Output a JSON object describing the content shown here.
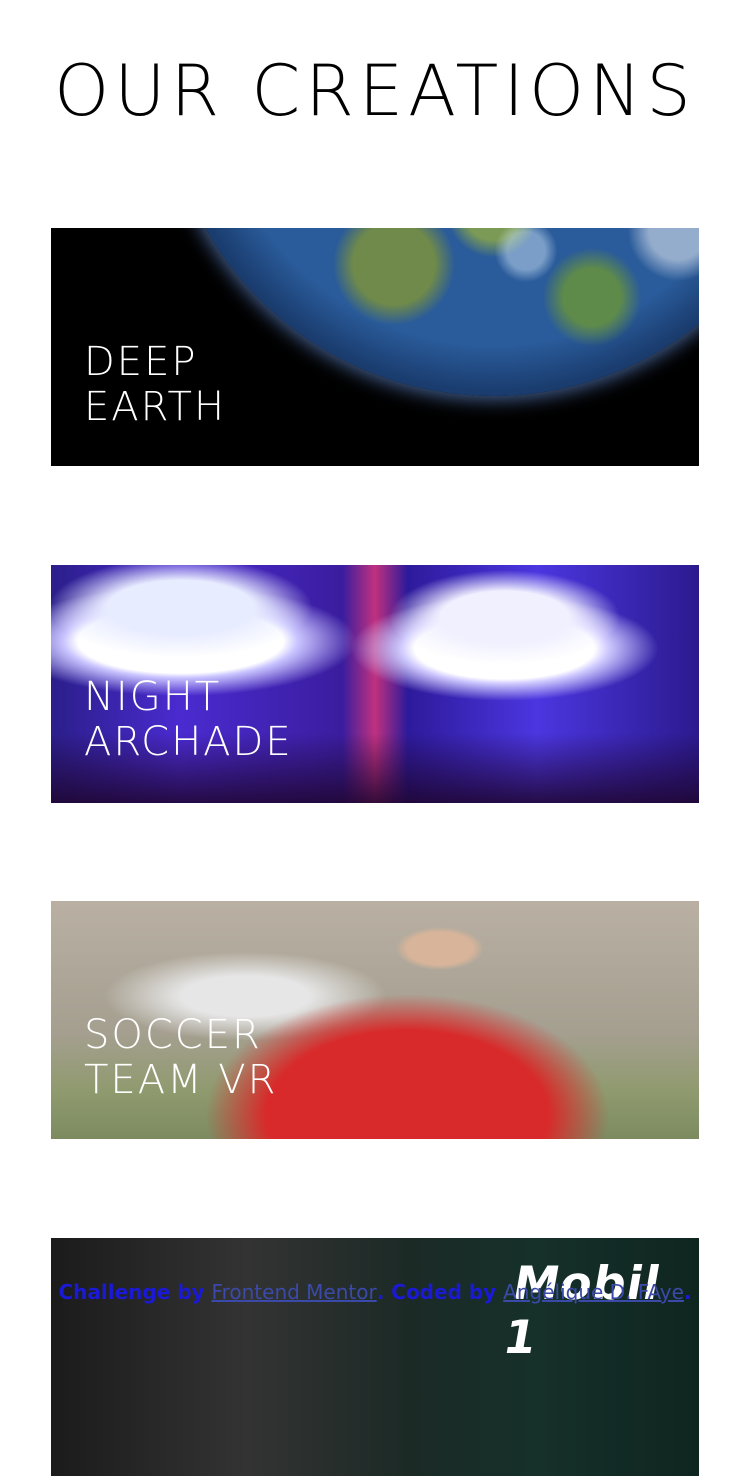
{
  "page": {
    "title": "OUR CREATIONS"
  },
  "creations": [
    {
      "line1": "DEEP",
      "line2": "EARTH"
    },
    {
      "line1": "NIGHT",
      "line2": "ARCHADE"
    },
    {
      "line1": "SOCCER",
      "line2": "TEAM VR"
    }
  ],
  "partial_card": {
    "brand_text": "Mobil 1"
  },
  "attribution": {
    "prefix": "Challenge by ",
    "link1": "Frontend Mentor",
    "middle": ". Coded by ",
    "link2": "Angélique D. FAye",
    "suffix": "."
  }
}
